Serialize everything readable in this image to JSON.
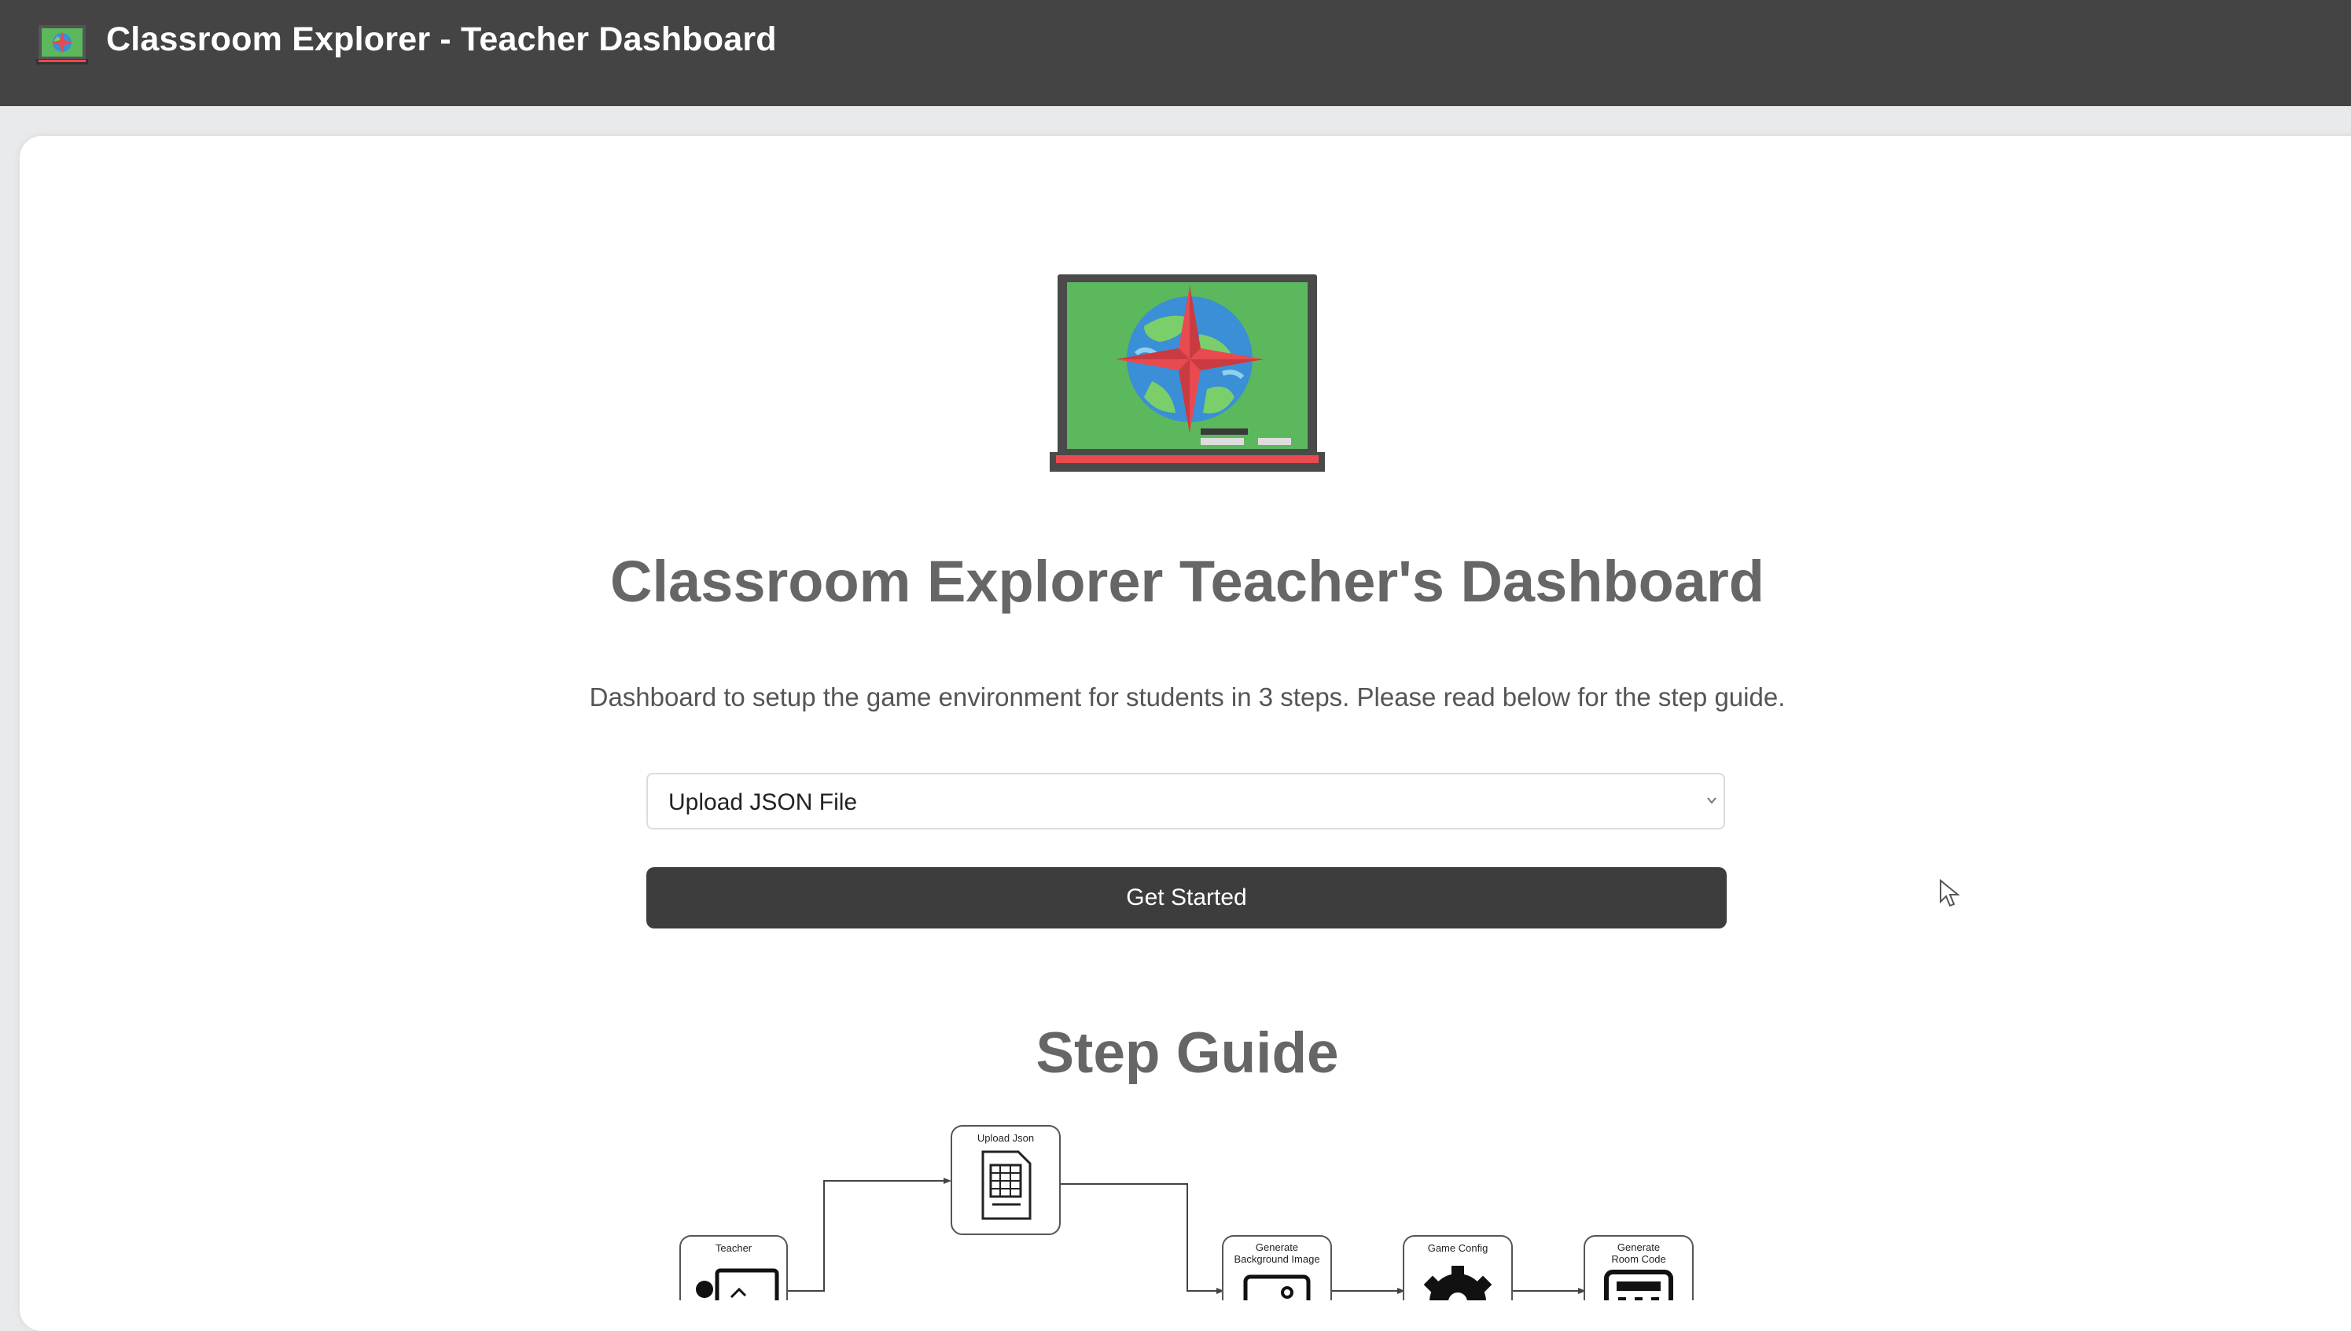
{
  "header": {
    "title": "Classroom Explorer - Teacher Dashboard",
    "logo_icon": "classroom-compass-logo"
  },
  "main": {
    "title": "Classroom Explorer Teacher's Dashboard",
    "subtitle": "Dashboard to setup the game environment for students in 3 steps. Please read below for the step guide.",
    "mode_select": {
      "selected": "Upload JSON File"
    },
    "get_started_label": "Get Started",
    "step_guide_title": "Step Guide"
  },
  "diagram": {
    "nodes": [
      {
        "id": "teacher",
        "label": "Teacher"
      },
      {
        "id": "upload",
        "label": "Upload Json"
      },
      {
        "id": "background",
        "label_line1": "Generate",
        "label_line2": "Background Image"
      },
      {
        "id": "config",
        "label": "Game Config"
      },
      {
        "id": "room",
        "label_line1": "Generate",
        "label_line2": "Room Code"
      }
    ]
  },
  "colors": {
    "topbar": "#444444",
    "button": "#3d3d3d",
    "heading": "#666666",
    "board_green": "#5cb85c",
    "compass_red": "#e84a4f"
  }
}
